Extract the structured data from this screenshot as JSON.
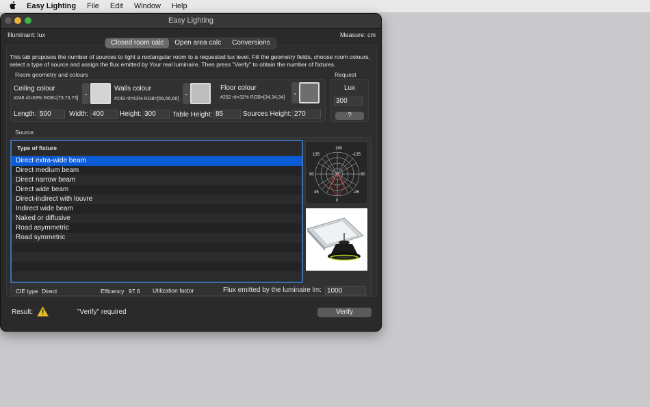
{
  "menubar": {
    "app_name": "Easy Lighting",
    "items": [
      "File",
      "Edit",
      "Window",
      "Help"
    ]
  },
  "window": {
    "title": "Easy Lighting",
    "illuminant": "Illuminant: lux",
    "measure": "Measure: cm"
  },
  "tabs": [
    "Closed room calc",
    "Open area calc",
    "Conversions"
  ],
  "description": "This tab proposes the number of sources to light a rectangular room to a requested lux level. Fill the geometry fields, choose room colours, select a type of source and assign the flux emitted by Your real luminaire. Then press \"Verify\" to obtain the number of fixtures.",
  "geometry": {
    "group_label": "Room geometry and colours",
    "ceiling": {
      "label": "Ceiling colour",
      "info": "#248 r/t=69% RGB=[73,73,73]",
      "swatch": "#d4d4d4"
    },
    "walls": {
      "label": "Walls colour",
      "info": "#249 r/t=63% RGB=[66,66,66]",
      "swatch": "#bdbdbd"
    },
    "floor": {
      "label": "Floor colour",
      "info": "#252 r/t=32% RGB=[34,34,34]",
      "swatch": "#6e6e6e"
    },
    "length_label": "Length:",
    "length": "500",
    "width_label": "Width:",
    "width": "400",
    "height_label": "Height:",
    "height": "300",
    "table_label": "Table Height:",
    "table": "85",
    "sources_label": "Sources Height:",
    "sources": "270"
  },
  "request": {
    "group_label": "Request",
    "lux_label": "Lux",
    "lux": "300",
    "help_button": "?"
  },
  "source": {
    "group_label": "Source",
    "column_header": "Type of fixture",
    "items": [
      "Direct extra-wide beam",
      "Direct medium beam",
      "Direct narrow beam",
      "Direct wide beam",
      "Direct-indirect with louvre",
      "Indirect wide beam",
      "Naked or diffusive",
      "Road asymmetric",
      "Road symmetric"
    ],
    "selected_index": 0,
    "polar_labels": {
      "top": "180",
      "tl": "135",
      "tr": "-135",
      "left": "90",
      "right": "-90",
      "bl": "45",
      "br": "-45",
      "bottom": "0"
    }
  },
  "footer": {
    "cie_type_label": "CIE type",
    "cie_type": "Direct",
    "efficiency_label": "Efficency",
    "efficiency": "97.6",
    "utilization_label": "Utilization factor",
    "flux_label": "Flux emitted by the luminaire lm:",
    "flux": "1000",
    "result_label": "Result:",
    "result_text": "\"Verify\" required",
    "verify_button": "Verify"
  },
  "colors": {
    "selection": "#0b5ad6",
    "warning": "#e8c02a",
    "traffic_red": "#5a5a5a",
    "traffic_yellow": "#e8b23a",
    "traffic_green": "#3fb44a"
  }
}
